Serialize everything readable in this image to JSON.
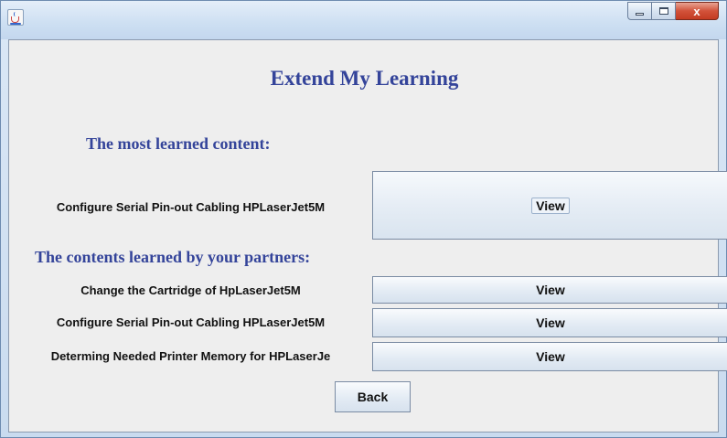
{
  "window": {
    "icon": "java-cup-icon",
    "controls": {
      "minimize": "minimize-icon",
      "maximize": "maximize-icon",
      "close": "close-icon",
      "close_glyph": "x"
    }
  },
  "main": {
    "title": "Extend My Learning",
    "most_learned_heading": "The most learned content:",
    "most_learned": {
      "label": "Configure Serial Pin-out Cabling HPLaserJet5M",
      "button": "View"
    },
    "partners_heading": "The contents learned by your partners:",
    "partners": [
      {
        "label": "Change the Cartridge of HpLaserJet5M",
        "button": "View"
      },
      {
        "label": "Configure Serial Pin-out Cabling HPLaserJet5M",
        "button": "View"
      },
      {
        "label": "Determing Needed Printer Memory for HPLaserJe",
        "button": "View"
      }
    ],
    "back_button": "Back"
  },
  "colors": {
    "heading": "#34449a",
    "close_button": "#c33b22",
    "titlebar": "#cddff2"
  }
}
